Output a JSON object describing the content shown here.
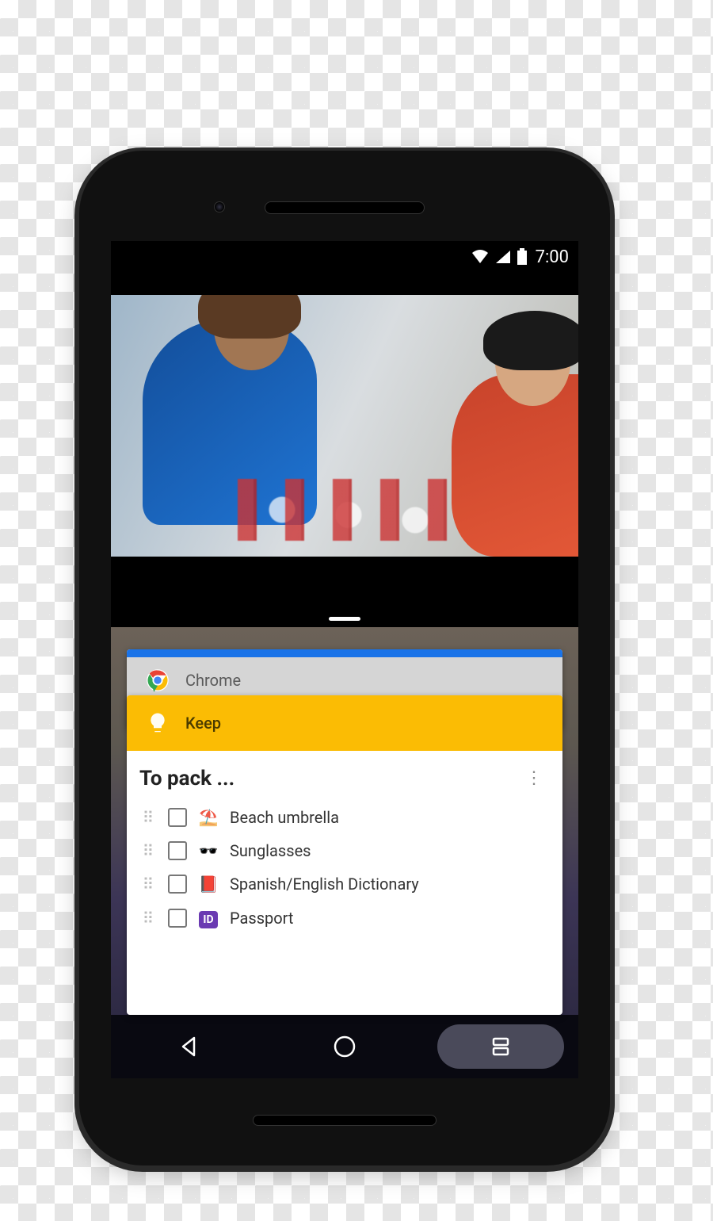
{
  "statusbar": {
    "time": "7:00"
  },
  "recents": {
    "chrome": {
      "label": "Chrome"
    },
    "keep": {
      "label": "Keep"
    }
  },
  "note": {
    "title": "To pack ...",
    "items": [
      {
        "label": "Beach umbrella"
      },
      {
        "label": "Sunglasses"
      },
      {
        "label": "Spanish/English Dictionary"
      },
      {
        "label": "Passport"
      }
    ]
  }
}
